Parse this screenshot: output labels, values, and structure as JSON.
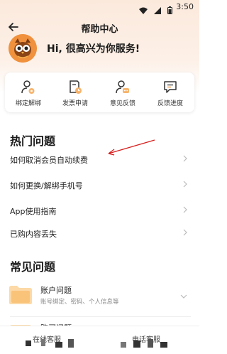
{
  "status": {
    "time": "3:50"
  },
  "nav": {
    "title": "帮助中心"
  },
  "greeting": {
    "text": "Hi, 很高兴为你服务!"
  },
  "quick_actions": [
    {
      "label": "绑定解绑",
      "icon": "user-gear-icon"
    },
    {
      "label": "发票申请",
      "icon": "invoice-clock-icon"
    },
    {
      "label": "意见反馈",
      "icon": "user-chat-icon"
    },
    {
      "label": "反馈进度",
      "icon": "message-progress-icon"
    }
  ],
  "hot": {
    "title": "热门问题",
    "items": [
      "如何取消会员自动续费",
      "如何更换/解绑手机号",
      "App使用指南",
      "已购内容丢失"
    ]
  },
  "common": {
    "title": "常见问题",
    "items": [
      {
        "title": "账户问题",
        "subtitle": "账号绑定、密码、个人信息等"
      },
      {
        "title": "购买问题",
        "subtitle": ""
      }
    ]
  },
  "bottom": {
    "left_label": "在线客服",
    "right_label": "电话客服"
  },
  "colors": {
    "accent": "#f0913e",
    "annotation_arrow": "#d81e1e",
    "icon_orange": "#f7b36b"
  }
}
